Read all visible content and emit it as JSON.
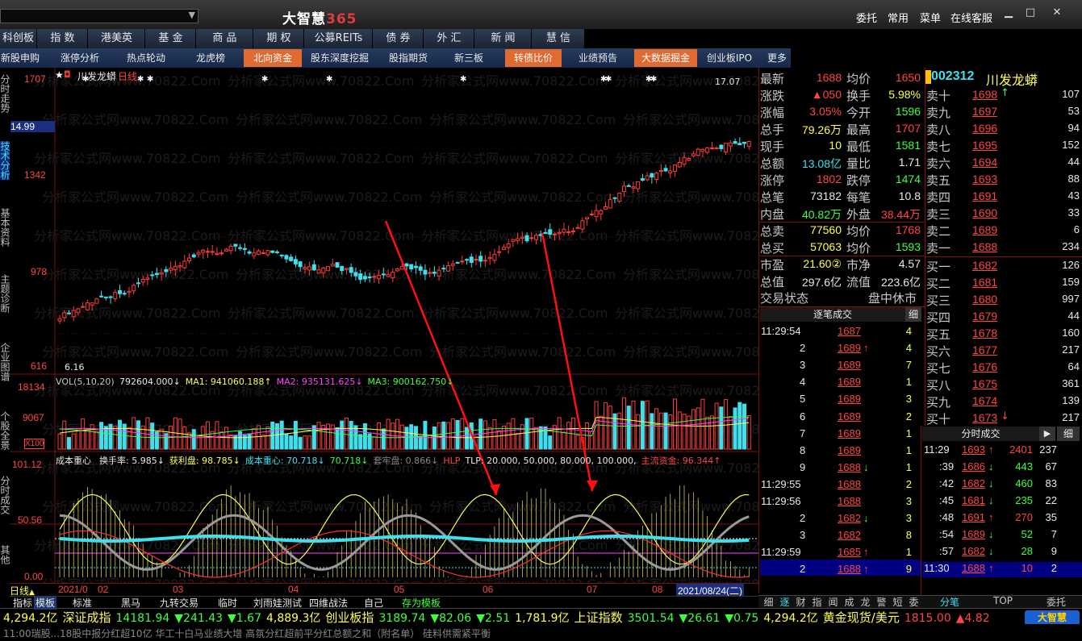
{
  "app": {
    "title_main": "大智慧",
    "title_num": "365",
    "watermark": "分析家公式网www.70822.Com"
  },
  "top_menu": [
    "委托",
    "常用",
    "菜单",
    "在线客服"
  ],
  "window_controls": {
    "minimize": "▁",
    "maximize": "□",
    "close": "✕"
  },
  "nav_tabs": [
    "科创板",
    "指 数",
    "港美英",
    "基 金",
    "商 品",
    "期 权",
    "公募REITs",
    "债 券",
    "外 汇",
    "新 闻",
    "慧 信"
  ],
  "sub_tabs": [
    {
      "label": "新股申购",
      "hl": false
    },
    {
      "label": "涨停分析",
      "hl": false
    },
    {
      "label": "热点轮动",
      "hl": false
    },
    {
      "label": "龙虎榜",
      "hl": false
    },
    {
      "label": "北向资金",
      "hl": true
    },
    {
      "label": "股东深度挖掘",
      "hl": false
    },
    {
      "label": "股指期货",
      "hl": false
    },
    {
      "label": "新三板",
      "hl": false
    },
    {
      "label": "转债比价",
      "hl": true
    },
    {
      "label": "业绩预告",
      "hl": false
    },
    {
      "label": "大数据掘金",
      "hl": true
    },
    {
      "label": "创业板IPO",
      "hl": false
    }
  ],
  "sub_more": "更多",
  "left_side_tabs": [
    "分时走势",
    "技术分析",
    "基本资料",
    "主题诊断",
    "企业图谱",
    "个股全景",
    "分时成交",
    "其他"
  ],
  "chart": {
    "stock_name": "川发龙蟒",
    "period": "日线",
    "price_axis": [
      "1707",
      "14.99",
      "1342",
      "978",
      "616"
    ],
    "high_mark": "17.07",
    "low_mark": "6.16",
    "vol_title": "VOL(5,10,20)",
    "vol_values": [
      {
        "text": "792604.000↓",
        "color": "#e8e8e8"
      },
      {
        "text": "MA1: 941060.188↑",
        "color": "#ffff4a"
      },
      {
        "text": "MA2: 935131.625↓",
        "color": "#ff44ff"
      },
      {
        "text": "MA3: 900162.750↓",
        "color": "#3dff3d"
      }
    ],
    "vol_axis": [
      "18134",
      "9067",
      "X100"
    ],
    "ind_title": "成本重心",
    "ind_values": [
      {
        "text": "换手率: 5.985↓",
        "color": "#e8e8e8"
      },
      {
        "text": "获利盘: 98.785↓",
        "color": "#ffff4a"
      },
      {
        "text": "成本重心: 70.718↓",
        "color": "#3ee0ee"
      },
      {
        "text": "70.718↓",
        "color": "#3dff3d"
      },
      {
        "text": "套牢盘: 0.866↓",
        "color": "#888888"
      },
      {
        "text": "HLP",
        "color": "#ff4444"
      },
      {
        "text": "TLP: 20.000, 50.000, 80.000, 100.000,",
        "color": "#e8e8e8"
      },
      {
        "text": "主流资金: 96.344↑",
        "color": "#ff4444"
      }
    ],
    "ind_axis": [
      "101.12",
      "50.56",
      "0.00"
    ],
    "date_axis": [
      "2021/0",
      "02",
      "03",
      "04",
      "05",
      "06",
      "07",
      "08",
      "2021/08/24(二)"
    ],
    "chart_tools": [
      "日线",
      "指标",
      "模板",
      "标准",
      "黑马",
      "九转交易",
      "临时",
      "刘雨娃测试",
      "四维战法",
      "自己",
      "存为模板"
    ]
  },
  "quote": {
    "rows": [
      [
        {
          "l": "最新",
          "v": "1688",
          "c": "red"
        },
        {
          "l": "均价",
          "v": "1650",
          "c": "red"
        }
      ],
      [
        {
          "l": "涨跌",
          "v": "▲050",
          "c": "red"
        },
        {
          "l": "换手",
          "v": "5.98%",
          "c": "yellow"
        }
      ],
      [
        {
          "l": "涨幅",
          "v": "3.05%",
          "c": "red"
        },
        {
          "l": "今开",
          "v": "1596",
          "c": "green"
        }
      ],
      [
        {
          "l": "总手",
          "v": "79.26万",
          "c": "yellow"
        },
        {
          "l": "最高",
          "v": "1707",
          "c": "red"
        }
      ],
      [
        {
          "l": "现手",
          "v": "10",
          "c": "yellow"
        },
        {
          "l": "最低",
          "v": "1581",
          "c": "green"
        }
      ],
      [
        {
          "l": "总额",
          "v": "13.08亿",
          "c": "cyan"
        },
        {
          "l": "量比",
          "v": "1.71",
          "c": "white"
        }
      ],
      [
        {
          "l": "涨停",
          "v": "1802",
          "c": "red"
        },
        {
          "l": "跌停",
          "v": "1474",
          "c": "green"
        }
      ],
      [
        {
          "l": "总笔",
          "v": "73182",
          "c": "white"
        },
        {
          "l": "每笔",
          "v": "10.8",
          "c": "white"
        }
      ],
      [
        {
          "l": "内盘",
          "v": "40.82万",
          "c": "green"
        },
        {
          "l": "外盘",
          "v": "38.44万",
          "c": "red"
        }
      ],
      [
        {
          "l": "总卖",
          "v": "77560",
          "c": "yellow"
        },
        {
          "l": "均价",
          "v": "1768",
          "c": "red"
        }
      ],
      [
        {
          "l": "总买",
          "v": "57063",
          "c": "yellow"
        },
        {
          "l": "均价",
          "v": "1593",
          "c": "green"
        }
      ],
      [
        {
          "l": "市盈",
          "v": "21.60②",
          "c": "yellow"
        },
        {
          "l": "市净",
          "v": "4.57",
          "c": "white"
        }
      ],
      [
        {
          "l": "总值",
          "v": "297.6亿",
          "c": "white"
        },
        {
          "l": "流值",
          "v": "223.6亿",
          "c": "white"
        }
      ]
    ],
    "status_label": "交易状态",
    "status_value": "盘中休市"
  },
  "stock_header": {
    "code": "002312",
    "name": "川发龙蟒"
  },
  "order_book": {
    "asks": [
      {
        "l": "卖十",
        "p": "1698",
        "v": "107",
        "arrow": "↑"
      },
      {
        "l": "卖九",
        "p": "1697",
        "v": "53"
      },
      {
        "l": "卖八",
        "p": "1696",
        "v": "94"
      },
      {
        "l": "卖七",
        "p": "1695",
        "v": "152"
      },
      {
        "l": "卖六",
        "p": "1694",
        "v": "44"
      },
      {
        "l": "卖五",
        "p": "1693",
        "v": "88"
      },
      {
        "l": "卖四",
        "p": "1691",
        "v": "43"
      },
      {
        "l": "卖三",
        "p": "1690",
        "v": "33"
      },
      {
        "l": "卖二",
        "p": "1689",
        "v": "6"
      },
      {
        "l": "卖一",
        "p": "1688",
        "v": "234"
      }
    ],
    "bids": [
      {
        "l": "买一",
        "p": "1682",
        "v": "126"
      },
      {
        "l": "买二",
        "p": "1681",
        "v": "159"
      },
      {
        "l": "买三",
        "p": "1680",
        "v": "997"
      },
      {
        "l": "买四",
        "p": "1679",
        "v": "44"
      },
      {
        "l": "买五",
        "p": "1678",
        "v": "160"
      },
      {
        "l": "买六",
        "p": "1677",
        "v": "217"
      },
      {
        "l": "买七",
        "p": "1676",
        "v": "64"
      },
      {
        "l": "买八",
        "p": "1675",
        "v": "361"
      },
      {
        "l": "买九",
        "p": "1674",
        "v": "139"
      },
      {
        "l": "买十",
        "p": "1673",
        "v": "217",
        "arrow": "↓"
      }
    ]
  },
  "ticks_left": {
    "title": "逐笔成交",
    "detail": "细",
    "rows": [
      {
        "t": "11:29:54",
        "p": "1687",
        "v": "4",
        "pc": "red",
        "a": ""
      },
      {
        "t": "2",
        "p": "1689",
        "v": "4",
        "pc": "red",
        "a": "↑"
      },
      {
        "t": "3",
        "p": "1689",
        "v": "7",
        "pc": "red",
        "a": ""
      },
      {
        "t": "4",
        "p": "1689",
        "v": "1",
        "pc": "red",
        "a": ""
      },
      {
        "t": "5",
        "p": "1689",
        "v": "3",
        "pc": "red",
        "a": ""
      },
      {
        "t": "6",
        "p": "1689",
        "v": "2",
        "pc": "red",
        "a": ""
      },
      {
        "t": "7",
        "p": "1689",
        "v": "1",
        "pc": "red",
        "a": ""
      },
      {
        "t": "8",
        "p": "1689",
        "v": "1",
        "pc": "red",
        "a": ""
      },
      {
        "t": "9",
        "p": "1688",
        "v": "1",
        "pc": "red",
        "a": "↓"
      },
      {
        "t": "11:29:55",
        "p": "1688",
        "v": "2",
        "pc": "red",
        "a": ""
      },
      {
        "t": "11:29:56",
        "p": "1688",
        "v": "3",
        "pc": "red",
        "a": ""
      },
      {
        "t": "2",
        "p": "1682",
        "v": "3",
        "pc": "red",
        "a": "↓"
      },
      {
        "t": "3",
        "p": "1682",
        "v": "8",
        "pc": "red",
        "a": ""
      },
      {
        "t": "11:29:59",
        "p": "1685",
        "v": "1",
        "pc": "red",
        "a": "↑"
      },
      {
        "t": "2",
        "p": "1688",
        "v": "9",
        "pc": "red",
        "a": "↑"
      }
    ],
    "tabs": [
      "细",
      "逐",
      "财",
      "指",
      "闻",
      "成",
      "龙",
      "警",
      "短",
      "委"
    ]
  },
  "ticks_right": {
    "title": "分时成交",
    "detail": "细",
    "rows": [
      {
        "t": "11:29",
        "p": "1693",
        "a": "↑",
        "v": "2401",
        "n": "237"
      },
      {
        "t": ":39",
        "p": "1686",
        "a": "↓",
        "v": "443",
        "n": "67"
      },
      {
        "t": ":42",
        "p": "1682",
        "a": "↓",
        "v": "460",
        "n": "83"
      },
      {
        "t": ":45",
        "p": "1681",
        "a": "↓",
        "v": "235",
        "n": "22"
      },
      {
        "t": ":48",
        "p": "1691",
        "a": "↑",
        "v": "270",
        "n": "35"
      },
      {
        "t": ":54",
        "p": "1689",
        "a": "↓",
        "v": "52",
        "n": "7"
      },
      {
        "t": ":57",
        "p": "1682",
        "a": "↓",
        "v": "28",
        "n": "9"
      },
      {
        "t": "11:30",
        "p": "1688",
        "a": "↑",
        "v": "10",
        "n": "2"
      }
    ],
    "tabs": [
      "分笔",
      "TOP",
      "委托"
    ]
  },
  "statusbar": [
    {
      "text": "4,294.2亿",
      "c": "yellow"
    },
    {
      "text": "深证成指",
      "c": "yellow"
    },
    {
      "text": "14181.94",
      "c": "green"
    },
    {
      "text": "▼241.43",
      "c": "green"
    },
    {
      "text": "▼1.67",
      "c": "green"
    },
    {
      "text": "4,889.3亿",
      "c": "yellow"
    },
    {
      "text": "创业板指",
      "c": "yellow"
    },
    {
      "text": "3189.74",
      "c": "green"
    },
    {
      "text": "▼82.06",
      "c": "green"
    },
    {
      "text": "▼2.51",
      "c": "green"
    },
    {
      "text": "1,781.9亿",
      "c": "yellow"
    },
    {
      "text": "上证指数",
      "c": "yellow"
    },
    {
      "text": "3501.54",
      "c": "green"
    },
    {
      "text": "▼26.61",
      "c": "green"
    },
    {
      "text": "▼0.75",
      "c": "green"
    },
    {
      "text": "4,294.2亿",
      "c": "yellow"
    },
    {
      "text": "黄金现货/美元",
      "c": "yellow"
    },
    {
      "text": "1815.00",
      "c": "red"
    },
    {
      "text": "▲4.82",
      "c": "red"
    }
  ],
  "bottom_ticker": "11:00瑞股...18股中报分红超10亿 华工十白马业绩大增 高氛分红超前平分红总额之和（附名单）    硅料供需紧平衡"
}
